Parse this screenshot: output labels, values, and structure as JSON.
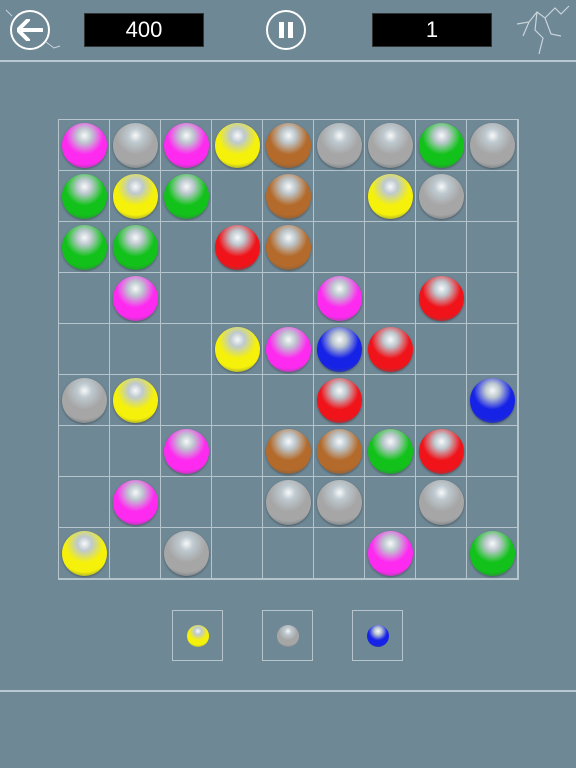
{
  "header": {
    "score": "400",
    "level": "1",
    "back_icon": "arrow-left-icon",
    "pause_icon": "pause-icon"
  },
  "colors": {
    "magenta": "#ff2af0",
    "gray": "#a6a6a6",
    "yellow": "#f5f10a",
    "brown": "#b46a2a",
    "green": "#12c21a",
    "red": "#f0141a",
    "blue": "#1622e6"
  },
  "board": {
    "rows": 9,
    "cols": 9,
    "grid": [
      [
        "magenta",
        "gray",
        "magenta",
        "yellow",
        "brown",
        "gray",
        "gray",
        "green",
        "gray"
      ],
      [
        "green",
        "yellow",
        "green",
        "",
        "brown",
        "",
        "yellow",
        "gray",
        ""
      ],
      [
        "green",
        "green",
        "",
        "red",
        "brown",
        "",
        "",
        "",
        ""
      ],
      [
        "",
        "magenta",
        "",
        "",
        "",
        "magenta",
        "",
        "red",
        ""
      ],
      [
        "",
        "",
        "",
        "yellow",
        "magenta",
        "blue",
        "red",
        "",
        ""
      ],
      [
        "gray",
        "yellow",
        "",
        "",
        "",
        "red",
        "",
        "",
        "blue"
      ],
      [
        "",
        "",
        "magenta",
        "",
        "brown",
        "brown",
        "green",
        "red",
        ""
      ],
      [
        "",
        "magenta",
        "",
        "",
        "gray",
        "gray",
        "",
        "gray",
        ""
      ],
      [
        "yellow",
        "",
        "gray",
        "",
        "",
        "",
        "magenta",
        "",
        "green"
      ]
    ]
  },
  "next_balls": [
    "yellow",
    "gray",
    "blue"
  ]
}
